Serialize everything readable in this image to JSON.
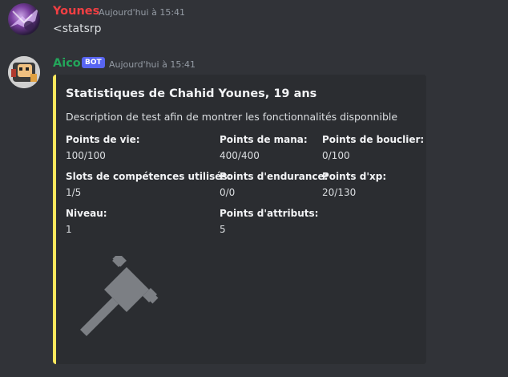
{
  "messages": [
    {
      "author": "Younes",
      "author_color": "#f23f43",
      "timestamp": "Aujourd'hui à 15:41",
      "content": "<statsrp"
    },
    {
      "author": "Aico",
      "author_color": "#23a55a",
      "bot_tag": "BOT",
      "timestamp": "Aujourd'hui à 15:41"
    }
  ],
  "embed": {
    "accent_color": "#fee75c",
    "title": "Statistiques de Chahid Younes, 19 ans",
    "description": "Description de test afin de montrer les fonctionnalités disponnible",
    "fields": [
      {
        "name": "Points de vie:",
        "value": "100/100"
      },
      {
        "name": "Points de mana:",
        "value": "400/400"
      },
      {
        "name": "Points de bouclier:",
        "value": "0/100"
      },
      {
        "name": "Slots de compétences utilisés:",
        "value": "1/5"
      },
      {
        "name": "Points d'endurance:",
        "value": "0/0"
      },
      {
        "name": "Points d'xp:",
        "value": "20/130"
      },
      {
        "name": "Niveau:",
        "value": "1"
      },
      {
        "name": "Points d'attributs:",
        "value": "5"
      }
    ],
    "thumbnail_icon": "pin-icon"
  }
}
